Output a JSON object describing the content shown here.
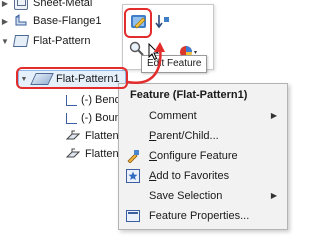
{
  "tree": {
    "items": [
      {
        "label": "Sheet-Metal",
        "icon": "sheet-metal-icon",
        "expanded": false
      },
      {
        "label": "Base-Flange1",
        "icon": "base-flange-icon",
        "expanded": false
      },
      {
        "label": "Flat-Pattern",
        "icon": "flat-pattern-folder-icon",
        "expanded": false
      },
      {
        "label": "Flat-Pattern1",
        "icon": "flat-pattern-feature-icon",
        "expanded": true,
        "selected": true
      },
      {
        "label": "(-) Bend",
        "icon": "sketch-line-icon"
      },
      {
        "label": "(-) Boun",
        "icon": "sketch-line-icon"
      },
      {
        "label": "Flatten-",
        "icon": "flatten-icon"
      },
      {
        "label": "Flatten-",
        "icon": "flatten-icon"
      }
    ]
  },
  "toolbar": {
    "tooltip": "Edit Feature",
    "buttons": [
      "edit-feature-icon",
      "rollback-icon",
      "zoom-to-selection-icon",
      "appearance-icon"
    ]
  },
  "context_menu": {
    "header": "Feature (Flat-Pattern1)",
    "items": [
      {
        "label": "Comment",
        "submenu": true
      },
      {
        "label": "Parent/Child...",
        "underline": "P"
      },
      {
        "label": "Configure Feature",
        "underline": "C"
      },
      {
        "label": "Add to Favorites",
        "underline": "A"
      },
      {
        "label": "Save Selection",
        "submenu": true
      },
      {
        "label": "Feature Properties..."
      }
    ]
  },
  "colors": {
    "highlight": "#e32c2c",
    "menu_bg": "#f2f2f2",
    "selection": "#e6f0fb"
  }
}
